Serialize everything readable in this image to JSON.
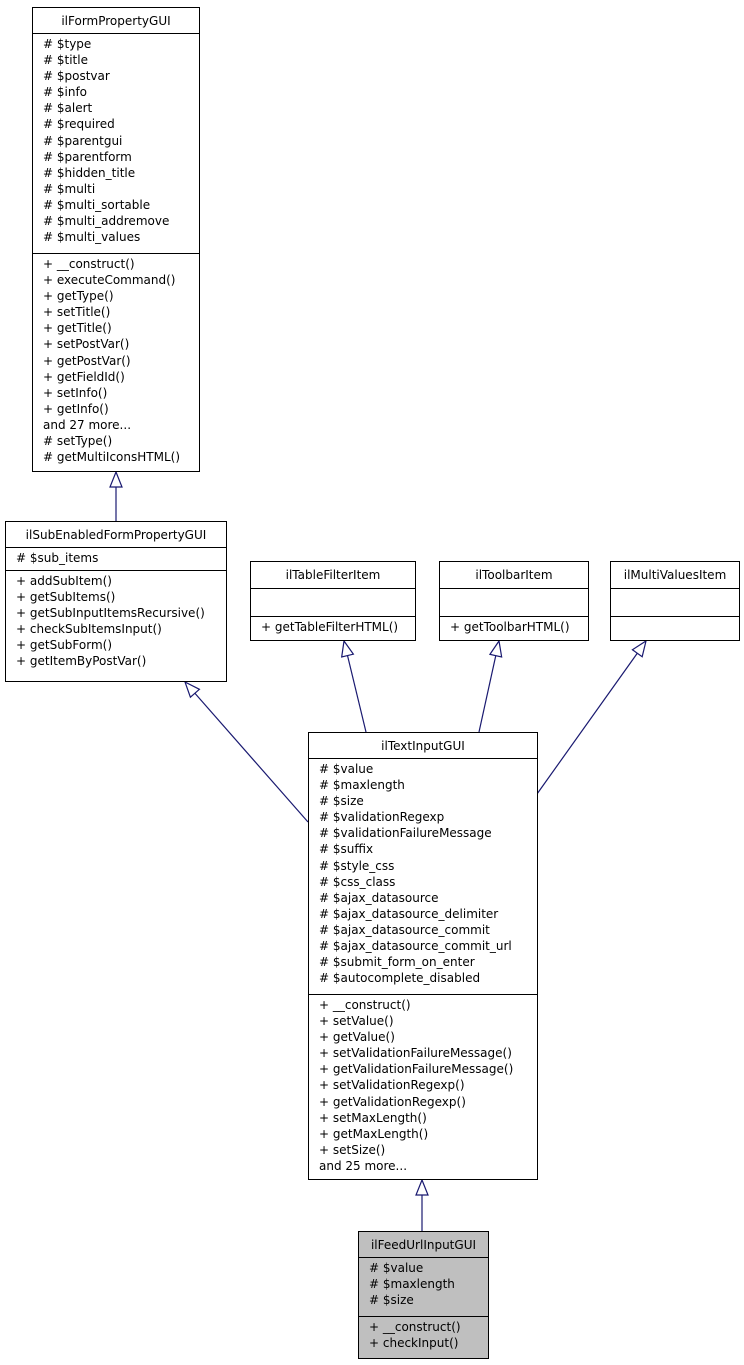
{
  "diagram": {
    "type": "inheritance-graph",
    "edge_color": "#191970",
    "current_fill": "#bfbfbf",
    "classes": {
      "ilFormPropertyGUI": {
        "name": "ilFormPropertyGUI",
        "attributes": [
          "# $type",
          "# $title",
          "# $postvar",
          "# $info",
          "# $alert",
          "# $required",
          "# $parentgui",
          "# $parentform",
          "# $hidden_title",
          "# $multi",
          "# $multi_sortable",
          "# $multi_addremove",
          "# $multi_values"
        ],
        "methods": [
          "+ __construct()",
          "+ executeCommand()",
          "+ getType()",
          "+ setTitle()",
          "+ getTitle()",
          "+ setPostVar()",
          "+ getPostVar()",
          "+ getFieldId()",
          "+ setInfo()",
          "+ getInfo()",
          "and 27 more...",
          "# setType()",
          "# getMultiIconsHTML()"
        ]
      },
      "ilSubEnabledFormPropertyGUI": {
        "name": "ilSubEnabledFormPropertyGUI",
        "attributes": [
          "# $sub_items"
        ],
        "methods": [
          "+ addSubItem()",
          "+ getSubItems()",
          "+ getSubInputItemsRecursive()",
          "+ checkSubItemsInput()",
          "+ getSubForm()",
          "+ getItemByPostVar()"
        ]
      },
      "ilTableFilterItem": {
        "name": "ilTableFilterItem",
        "attributes": [],
        "methods": [
          "+ getTableFilterHTML()"
        ]
      },
      "ilToolbarItem": {
        "name": "ilToolbarItem",
        "attributes": [],
        "methods": [
          "+ getToolbarHTML()"
        ]
      },
      "ilMultiValuesItem": {
        "name": "ilMultiValuesItem",
        "attributes": [],
        "methods": []
      },
      "ilTextInputGUI": {
        "name": "ilTextInputGUI",
        "attributes": [
          "# $value",
          "# $maxlength",
          "# $size",
          "# $validationRegexp",
          "# $validationFailureMessage",
          "# $suffix",
          "# $style_css",
          "# $css_class",
          "# $ajax_datasource",
          "# $ajax_datasource_delimiter",
          "# $ajax_datasource_commit",
          "# $ajax_datasource_commit_url",
          "# $submit_form_on_enter",
          "# $autocomplete_disabled"
        ],
        "methods": [
          "+ __construct()",
          "+ setValue()",
          "+ getValue()",
          "+ setValidationFailureMessage()",
          "+ getValidationFailureMessage()",
          "+ setValidationRegexp()",
          "+ getValidationRegexp()",
          "+ setMaxLength()",
          "+ getMaxLength()",
          "+ setSize()",
          "and 25 more..."
        ]
      },
      "ilFeedUrlInputGUI": {
        "name": "ilFeedUrlInputGUI",
        "attributes": [
          "# $value",
          "# $maxlength",
          "# $size"
        ],
        "methods": [
          "+ __construct()",
          "+ checkInput()"
        ]
      }
    },
    "edges": [
      {
        "from": "ilSubEnabledFormPropertyGUI",
        "to": "ilFormPropertyGUI",
        "kind": "inherits"
      },
      {
        "from": "ilTextInputGUI",
        "to": "ilSubEnabledFormPropertyGUI",
        "kind": "inherits"
      },
      {
        "from": "ilTextInputGUI",
        "to": "ilTableFilterItem",
        "kind": "implements"
      },
      {
        "from": "ilTextInputGUI",
        "to": "ilToolbarItem",
        "kind": "implements"
      },
      {
        "from": "ilTextInputGUI",
        "to": "ilMultiValuesItem",
        "kind": "implements"
      },
      {
        "from": "ilFeedUrlInputGUI",
        "to": "ilTextInputGUI",
        "kind": "inherits"
      }
    ]
  }
}
